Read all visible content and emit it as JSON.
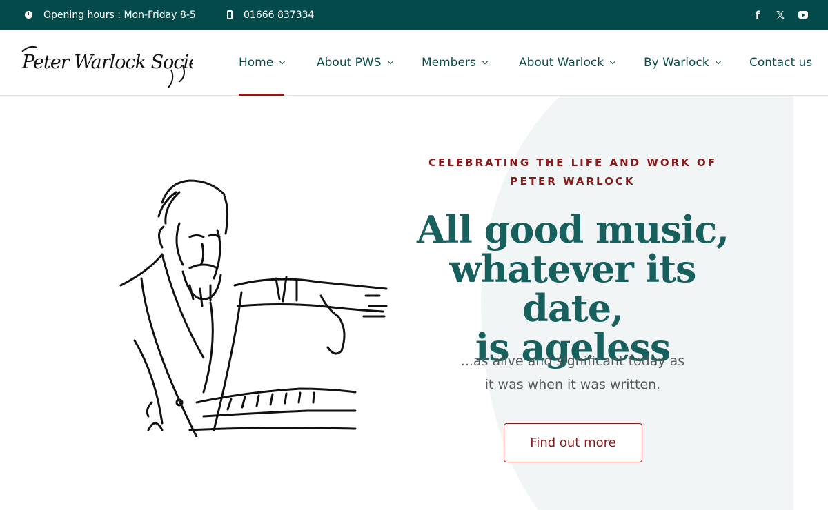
{
  "topbar": {
    "hours": "Opening hours : Mon-Friday 8-5",
    "phone": "01666 837334",
    "social": [
      "facebook-icon",
      "x-icon",
      "youtube-icon"
    ],
    "facebook_glyph": "f",
    "x_glyph": "𝕏"
  },
  "logo": {
    "text": "Peter Warlock Society"
  },
  "nav": {
    "items": [
      {
        "label": "Home",
        "dropdown": true,
        "active": true
      },
      {
        "label": "About PWS",
        "dropdown": true
      },
      {
        "label": "Members",
        "dropdown": true
      },
      {
        "label": "About Warlock",
        "dropdown": true
      },
      {
        "label": "By Warlock",
        "dropdown": true
      },
      {
        "label": "Contact us",
        "dropdown": false
      }
    ]
  },
  "hero": {
    "kicker_line1": "CELEBRATING THE LIFE AND WORK OF",
    "kicker_line2": "PETER WARLOCK",
    "headline_line1": "All good music,",
    "headline_line2": "whatever its date,",
    "headline_line3": "is ageless",
    "sub_line1": "...as alive and significant today as",
    "sub_line2": "it was when it was written.",
    "cta": "Find out more"
  },
  "colors": {
    "topbar_bg": "#054a4a",
    "nav_text": "#0b4d4d",
    "accent_red": "#8b1a1a",
    "headline": "#17605e",
    "hero_panel": "#f2f5f6"
  }
}
